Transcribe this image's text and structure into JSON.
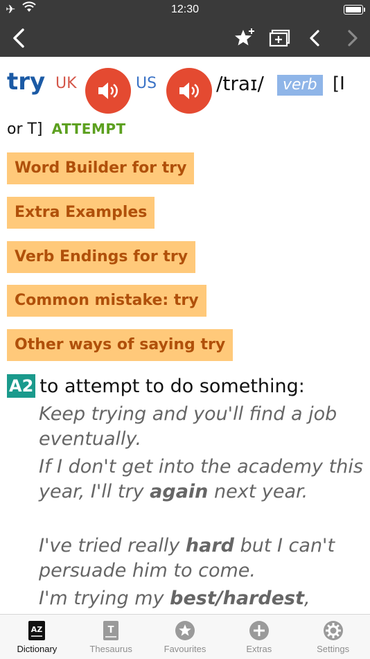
{
  "status": {
    "time": "12:30"
  },
  "entry": {
    "headword": "try",
    "uk_label": "UK",
    "us_label": "US",
    "pronunciation": "/traɪ/",
    "part_of_speech": "verb",
    "grammar_part1": "[I",
    "grammar_part2": "or T]",
    "guideword": "ATTEMPT"
  },
  "panels": [
    {
      "label": "Word Builder for try"
    },
    {
      "label": "Extra Examples"
    },
    {
      "label": "Verb Endings for try"
    },
    {
      "label": "Common mistake: try"
    },
    {
      "label": "Other ways of saying try"
    }
  ],
  "sense": {
    "level": "A2",
    "definition": "to attempt to do something:",
    "examples": [
      {
        "parts": [
          "Keep trying and you'll find a job eventually."
        ]
      },
      {
        "before": "If I don't get into the academy this year, I'll try ",
        "bold": "again",
        "after": " next year."
      },
      {
        "before": "I've tried really ",
        "bold": "hard",
        "after": " but I can't persuade him to come."
      },
      {
        "before": "I'm trying my ",
        "bold": "best/hardest",
        "after": ","
      }
    ]
  },
  "tabs": [
    {
      "label": "Dictionary",
      "icon": "dictionary-icon"
    },
    {
      "label": "Thesaurus",
      "icon": "thesaurus-icon"
    },
    {
      "label": "Favourites",
      "icon": "star-circle-icon"
    },
    {
      "label": "Extras",
      "icon": "plus-circle-icon"
    },
    {
      "label": "Settings",
      "icon": "gear-icon"
    }
  ],
  "colors": {
    "topbar": "#3a3a3a",
    "headword": "#1b5aa5",
    "speaker": "#e44a31",
    "panel_bg": "#ffc97a",
    "panel_text": "#b0500a",
    "level_bg": "#1a9a8c",
    "guideword": "#5ca01f"
  }
}
